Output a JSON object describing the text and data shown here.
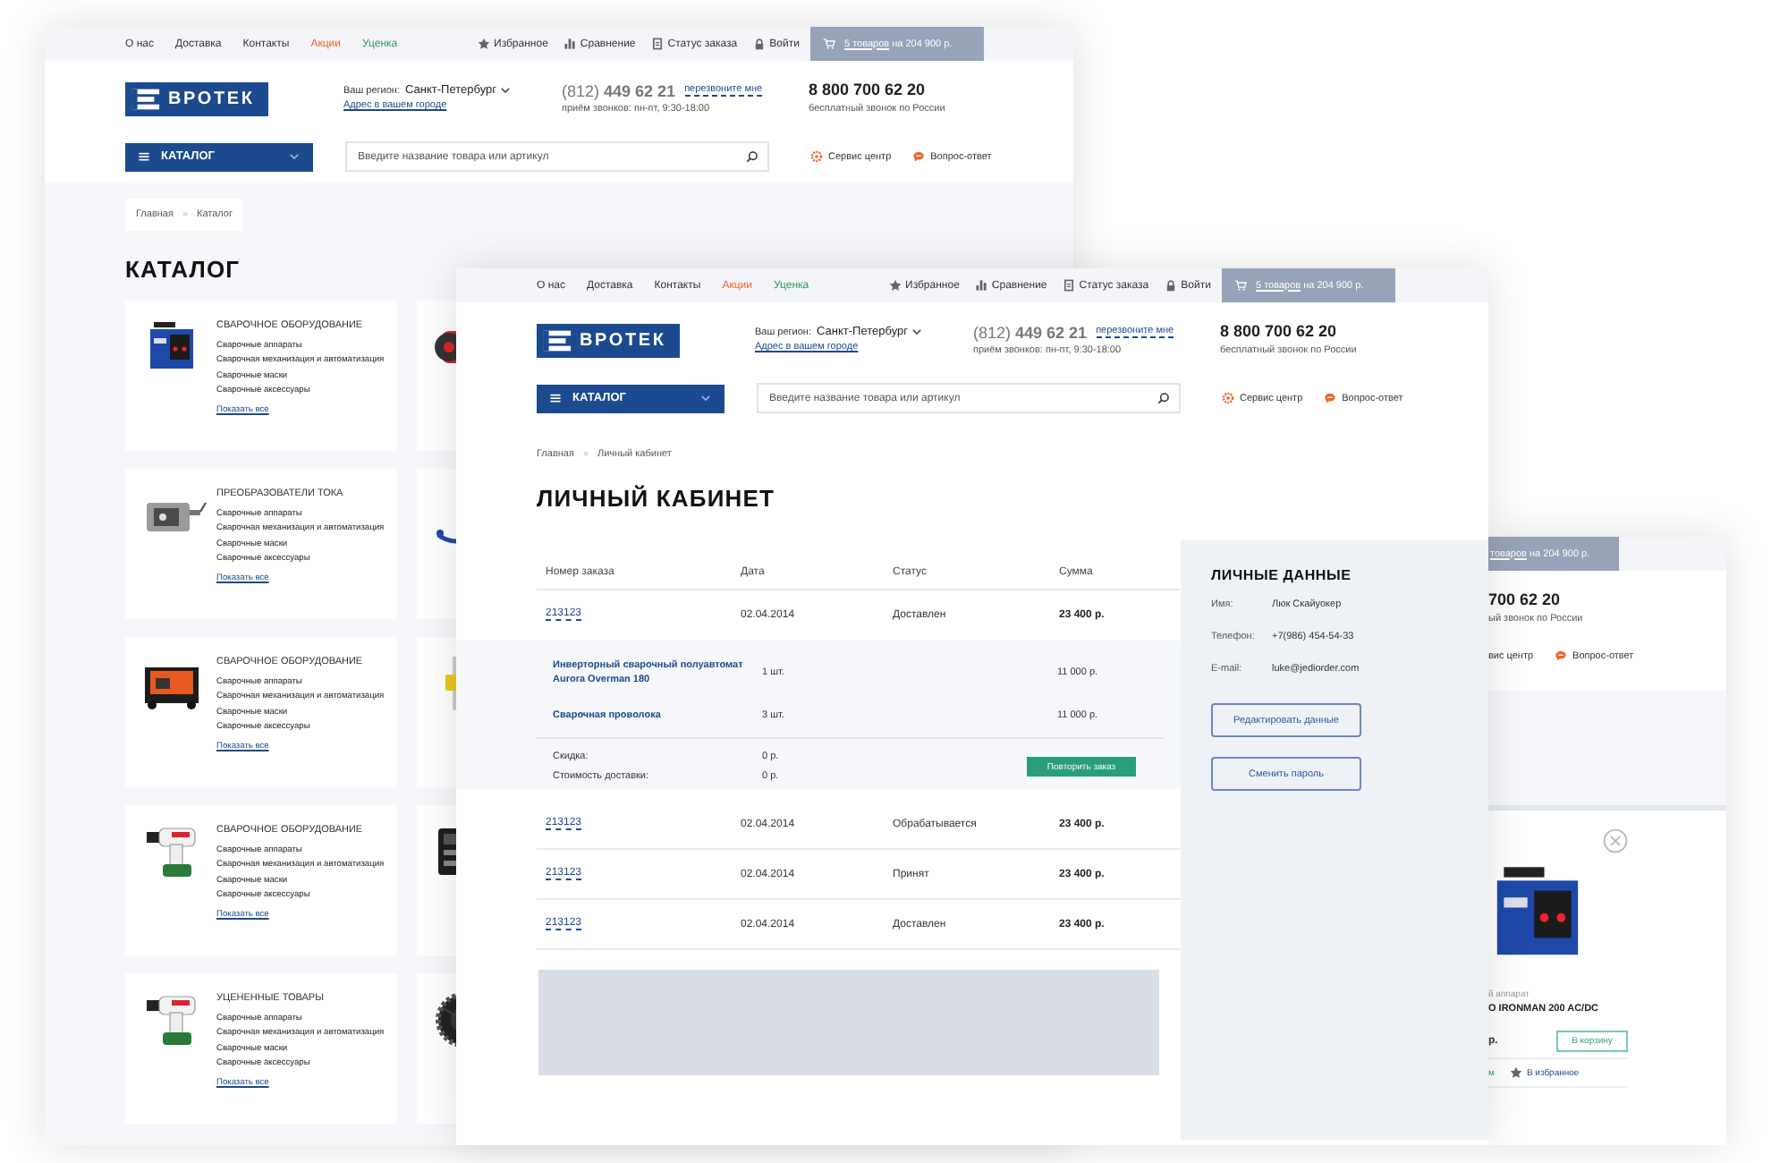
{
  "catalog_page": {
    "header": {
      "top_links": [
        {
          "label": "О нас",
          "color": "#333333"
        },
        {
          "label": "Доставка",
          "color": "#333333"
        },
        {
          "label": "Контакты",
          "color": "#333333"
        },
        {
          "label": "Акции",
          "color": "#f0642a"
        },
        {
          "label": "Уценка",
          "color": "#2e9a52"
        }
      ],
      "user_links": [
        {
          "label": "Избранное"
        },
        {
          "label": "Сравнение"
        },
        {
          "label": "Статус заказа"
        },
        {
          "label": "Войти"
        }
      ],
      "cart": {
        "link": "5 товаров",
        "text": " на 204 900 р."
      },
      "logo": "ВРОТЕК",
      "region": {
        "label": "Ваш регион:",
        "value": "Санкт-Петербург",
        "address_link": "Адрес в вашем городе"
      },
      "phone": {
        "number": "(812) **449 62 21**",
        "callback": "перезвоните мне",
        "hours": "приём звонков: пн-пт, 9:30-18:00"
      },
      "free_phone": {
        "number": "8 800 700 62 20",
        "note": "бесплатный звонок по России"
      },
      "catalog_button": "КАТАЛОГ",
      "search": {
        "placeholder": "Введите название товара или артикул"
      },
      "service_links": [
        {
          "label": "Сервис центр"
        },
        {
          "label": "Вопрос-ответ"
        }
      ]
    },
    "breadcrumb": {
      "items": [
        "Главная",
        "Каталог"
      ],
      "separator": "»"
    },
    "title": "КАТАЛОГ",
    "categories": [
      {
        "title": "СВАРОЧНОЕ ОБОРУДОВАНИЕ",
        "links": [
          "Сварочные аппараты",
          "Сварочная механизация и автоматизация",
          "Сварочные маски",
          "Сварочные аксессуары"
        ],
        "show_all": "Показать все"
      },
      {
        "title": "ПРЕОБРАЗОВАТЕЛИ ТОКА",
        "links": [
          "Сварочные аппараты",
          "Сварочная механизация и автоматизация",
          "Сварочные маски",
          "Сварочные аксессуары"
        ],
        "show_all": "Показать все"
      },
      {
        "title": "СВАРОЧНОЕ ОБОРУДОВАНИЕ",
        "links": [
          "Сварочные аппараты",
          "Сварочная механизация и автоматизация",
          "Сварочные маски",
          "Сварочные аксессуары"
        ],
        "show_all": "Показать все"
      },
      {
        "title": "СВАРОЧНОЕ ОБОРУДОВАНИЕ",
        "links": [
          "Сварочные аппараты",
          "Сварочная механизация и автоматизация",
          "Сварочные маски",
          "Сварочные аксессуары"
        ],
        "show_all": "Показать все"
      },
      {
        "title": "УЦЕНЕННЫЕ ТОВАРЫ",
        "links": [
          "Сварочные аппараты",
          "Сварочная механизация и автоматизация",
          "Сварочные маски",
          "Сварочные аксессуары"
        ],
        "show_all": "Показать все"
      }
    ]
  },
  "account_page": {
    "header": {
      "top_links": [
        {
          "label": "О нас",
          "color": "#333333"
        },
        {
          "label": "Доставка",
          "color": "#333333"
        },
        {
          "label": "Контакты",
          "color": "#333333"
        },
        {
          "label": "Акции",
          "color": "#f0642a"
        },
        {
          "label": "Уценка",
          "color": "#2e9a52"
        }
      ],
      "user_links": [
        {
          "label": "Избранное"
        },
        {
          "label": "Сравнение"
        },
        {
          "label": "Статус заказа"
        },
        {
          "label": "Войти"
        }
      ],
      "cart": {
        "link": "5 товаров",
        "text": " на 204 900 р."
      },
      "logo": "ВРОТЕК",
      "region": {
        "label": "Ваш регион:",
        "value": "Санкт-Петербург",
        "address_link": "Адрес в вашем городе"
      },
      "phone": {
        "number": "(812) **449 62 21**",
        "callback": "перезвоните мне",
        "hours": "приём звонков: пн-пт, 9:30-18:00"
      },
      "free_phone": {
        "number": "8 800 700 62 20",
        "note": "бесплатный звонок по России"
      },
      "catalog_button": "КАТАЛОГ",
      "search": {
        "placeholder": "Введите название товара или артикул"
      },
      "service_links": [
        {
          "label": "Сервис центр"
        },
        {
          "label": "Вопрос-ответ"
        }
      ]
    },
    "breadcrumb": {
      "items": [
        "Главная",
        "Личный кабинет"
      ],
      "separator": "»"
    },
    "title": "ЛИЧНЫЙ КАБИНЕТ",
    "orders": {
      "columns": [
        "Номер заказа",
        "Дата",
        "Статус",
        "Сумма"
      ],
      "rows": [
        {
          "number": "213123",
          "date": "02.04.2014",
          "status": "Доставлен",
          "sum": "23 400 р.",
          "expanded": true,
          "items": [
            {
              "name": "Инверторный сварочный полуавтомат Aurora Overman 180",
              "qty": "1 шт.",
              "sum": "11 000 р."
            },
            {
              "name": "Сварочная проволока",
              "qty": "3 шт.",
              "sum": "11 000 р."
            }
          ],
          "totals": [
            {
              "label": "Скидка:",
              "value": "0 р."
            },
            {
              "label": "Стоимость доставки:",
              "value": "0 р."
            }
          ],
          "repeat_button": "Повторить заказ"
        },
        {
          "number": "213123",
          "date": "02.04.2014",
          "status": "Обрабатывается",
          "sum": "23 400 р.",
          "expanded": false
        },
        {
          "number": "213123",
          "date": "02.04.2014",
          "status": "Принят",
          "sum": "23 400 р.",
          "expanded": false
        },
        {
          "number": "213123",
          "date": "02.04.2014",
          "status": "Доставлен",
          "sum": "23 400 р.",
          "expanded": false
        }
      ]
    },
    "personal_data": {
      "title": "ЛИЧНЫЕ ДАННЫЕ",
      "fields": [
        {
          "label": "Имя:",
          "value": "Люк Скайуокер"
        },
        {
          "label": "Телефон:",
          "value": "+7(986) 454-54-33"
        },
        {
          "label": "E-mail:",
          "value": "luke@jediorder.com"
        }
      ],
      "buttons": [
        "Редактировать данные",
        "Сменить пароль"
      ]
    }
  },
  "product_page": {
    "cart": {
      "link": "товаров",
      "text": " на 204 900 р."
    },
    "free_phone": {
      "number": "700 62 20",
      "note": "ый звонок по России"
    },
    "service_links": [
      {
        "label": "вис центр"
      },
      {
        "label": "Вопрос-ответ"
      }
    ],
    "product": {
      "category": "й аппарат",
      "name": "O IRONMAN 200 AC/DC",
      "price": "р.",
      "cart_button": "В корзину",
      "stock": "м",
      "favorite": "В избранное"
    }
  }
}
